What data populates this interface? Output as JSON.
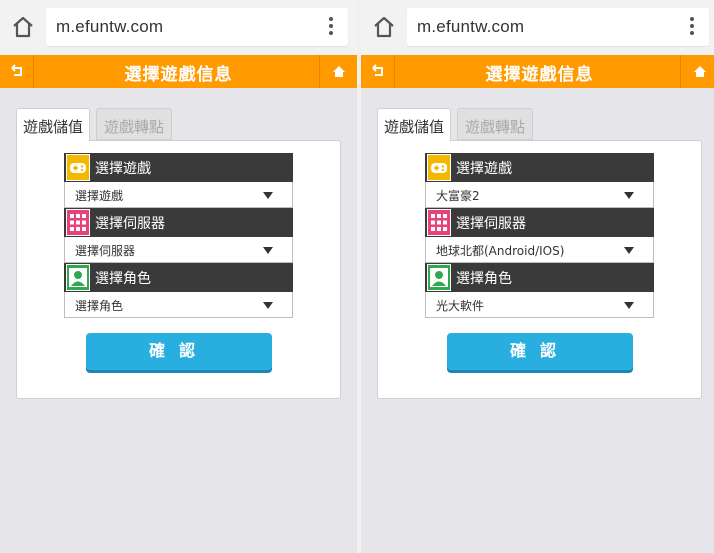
{
  "colors": {
    "accent_orange": "#ff9a00",
    "button_blue": "#29aee0",
    "section_dark": "#3a3a3a",
    "icon_game_bg": "#f5b800",
    "icon_server_bg": "#e8427a",
    "icon_role_bg": "#2fa84f"
  },
  "screens": [
    {
      "url": "m.efuntw.com",
      "title": "選擇遊戲信息",
      "tabs": [
        "遊戲儲值",
        "遊戲轉點"
      ],
      "sections": [
        {
          "icon": "gamepad-icon",
          "label": "選擇遊戲",
          "value": "選擇遊戲"
        },
        {
          "icon": "server-grid-icon",
          "label": "選擇伺服器",
          "value": "選擇伺服器"
        },
        {
          "icon": "user-icon",
          "label": "選擇角色",
          "value": "選擇角色"
        }
      ],
      "confirm_label": "確認"
    },
    {
      "url": "m.efuntw.com",
      "title": "選擇遊戲信息",
      "tabs": [
        "遊戲儲值",
        "遊戲轉點"
      ],
      "sections": [
        {
          "icon": "gamepad-icon",
          "label": "選擇遊戲",
          "value": "大富豪2"
        },
        {
          "icon": "server-grid-icon",
          "label": "選擇伺服器",
          "value": "地球北都(Android/IOS)"
        },
        {
          "icon": "user-icon",
          "label": "選擇角色",
          "value": "光大軟件"
        }
      ],
      "confirm_label": "確認"
    }
  ]
}
